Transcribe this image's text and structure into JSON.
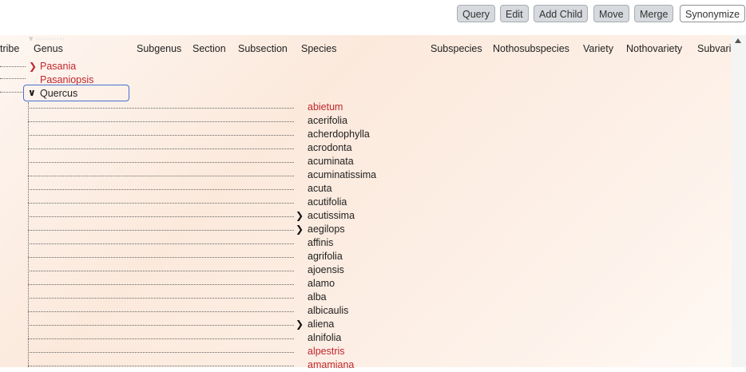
{
  "toolbar": {
    "buttons": [
      "Query",
      "Edit",
      "Add Child",
      "Move",
      "Merge",
      "Synonymize"
    ]
  },
  "columns": [
    "tribe",
    "Genus",
    "Subgenus",
    "Section",
    "Subsection",
    "Species",
    "Subspecies",
    "Nothosubspecies",
    "Variety",
    "Nothovariety",
    "Subvari"
  ],
  "genera": [
    {
      "name": "Pasania",
      "expanded": false,
      "red": true
    },
    {
      "name": "Pasaniopsis",
      "expanded": false,
      "red": true
    },
    {
      "name": "Quercus",
      "expanded": true,
      "red": false
    }
  ],
  "species": [
    {
      "name": "abietum",
      "red": true,
      "has_children": false
    },
    {
      "name": "acerifolia",
      "red": false,
      "has_children": false
    },
    {
      "name": "acherdophylla",
      "red": false,
      "has_children": false
    },
    {
      "name": "acrodonta",
      "red": false,
      "has_children": false
    },
    {
      "name": "acuminata",
      "red": false,
      "has_children": false
    },
    {
      "name": "acuminatissima",
      "red": false,
      "has_children": false
    },
    {
      "name": "acuta",
      "red": false,
      "has_children": false
    },
    {
      "name": "acutifolia",
      "red": false,
      "has_children": false
    },
    {
      "name": "acutissima",
      "red": false,
      "has_children": true
    },
    {
      "name": "aegilops",
      "red": false,
      "has_children": true
    },
    {
      "name": "affinis",
      "red": false,
      "has_children": false
    },
    {
      "name": "agrifolia",
      "red": false,
      "has_children": false
    },
    {
      "name": "ajoensis",
      "red": false,
      "has_children": false
    },
    {
      "name": "alamo",
      "red": false,
      "has_children": false
    },
    {
      "name": "alba",
      "red": false,
      "has_children": false
    },
    {
      "name": "albicaulis",
      "red": false,
      "has_children": false
    },
    {
      "name": "aliena",
      "red": false,
      "has_children": true
    },
    {
      "name": "alnifolia",
      "red": false,
      "has_children": false
    },
    {
      "name": "alpestris",
      "red": true,
      "has_children": false
    },
    {
      "name": "amamiana",
      "red": true,
      "has_children": false
    }
  ],
  "colors": {
    "accent": "#4a6fd0",
    "red_text": "#c0272d",
    "button_bg": "#d6d9dd"
  }
}
